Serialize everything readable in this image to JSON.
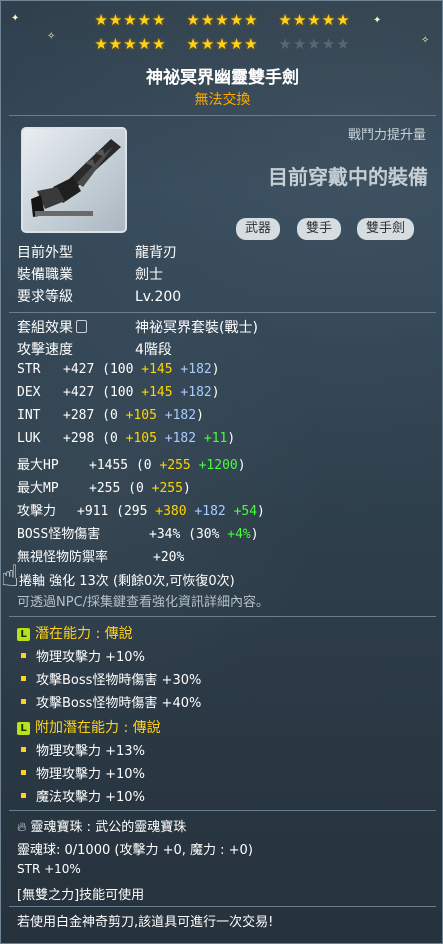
{
  "stars": {
    "row1": [
      "★★★★★",
      "★★★★★",
      "★★★★★"
    ],
    "row2": [
      "★★★★★",
      "★★★★★"
    ],
    "row2_off": "★★★★★"
  },
  "item": {
    "name": "神祕冥界幽靈雙手劍",
    "trade": "無法交換",
    "cp_label": "戰鬥力提升量",
    "wearing": "目前穿戴中的裝備",
    "tags": [
      "武器",
      "雙手",
      "雙手劍"
    ]
  },
  "info": [
    {
      "k": "目前外型",
      "v": "龍背刃"
    },
    {
      "k": "裝備職業",
      "v": "劍士"
    },
    {
      "k": "要求等級",
      "v": "Lv.200"
    }
  ],
  "set": {
    "k": "套組效果",
    "v": "神祕冥界套裝(戰士)"
  },
  "speed": {
    "k": "攻擊速度",
    "v": "4階段"
  },
  "stats": [
    {
      "name": "STR",
      "total": "+427",
      "open": "(100",
      "y": "+145",
      "b": "+182",
      "g": "",
      "close": ")"
    },
    {
      "name": "DEX",
      "total": "+427",
      "open": "(100",
      "y": "+145",
      "b": "+182",
      "g": "",
      "close": ")"
    },
    {
      "name": "INT",
      "total": "+287",
      "open": "(0",
      "y": "+105",
      "b": "+182",
      "g": "",
      "close": ")"
    },
    {
      "name": "LUK",
      "total": "+298",
      "open": "(0",
      "y": "+105",
      "b": "+182",
      "g": "+11",
      "close": ")"
    },
    {
      "name": "最大HP",
      "total": "+1455",
      "open": "(0",
      "y": "+255",
      "b": "",
      "g": "+1200",
      "close": ")"
    },
    {
      "name": "最大MP",
      "total": "+255",
      "open": "(0",
      "y": "+255",
      "b": "",
      "g": "",
      "close": ")"
    },
    {
      "name": "攻擊力",
      "total": "+911",
      "open": "(295",
      "y": "+380",
      "b": "+182",
      "g": "+54",
      "close": ")"
    },
    {
      "name": "BOSS怪物傷害",
      "total": "+34%",
      "open": "(30%",
      "y": "",
      "b": "",
      "g": "+4%",
      "close": ")"
    },
    {
      "name": "無視怪物防禦率",
      "total": "+20%",
      "open": "",
      "y": "",
      "b": "",
      "g": "",
      "close": ""
    }
  ],
  "scroll": "捲軸 強化 13次 (剩餘0次,可恢復0次)",
  "scroll_note": "可透過NPC/採集鍵查看強化資訊詳細內容。",
  "potential": {
    "icon": "L",
    "title": "潛在能力 : 傳說",
    "lines": [
      "物理攻擊力 +10%",
      "攻擊Boss怪物時傷害 +30%",
      "攻擊Boss怪物時傷害 +40%"
    ]
  },
  "bonus": {
    "icon": "L",
    "title": "附加潛在能力 : 傳說",
    "lines": [
      "物理攻擊力 +13%",
      "物理攻擊力 +10%",
      "魔法攻擊力 +10%"
    ]
  },
  "soul": {
    "title": "靈魂寶珠 : 武公的靈魂寶珠",
    "line1": "靈魂球: 0/1000 (攻擊力 +0, 魔力 : +0)",
    "line2": "STR +10%",
    "skill": "[無雙之力]技能可使用"
  },
  "footer": "若使用白金神奇剪刀,該道具可進行一次交易!",
  "colors": {
    "gold": "#ffd21a",
    "orange": "#ffaa00",
    "yellow": "#ffd500",
    "blue": "#aaccff",
    "green": "#47ff3a"
  }
}
